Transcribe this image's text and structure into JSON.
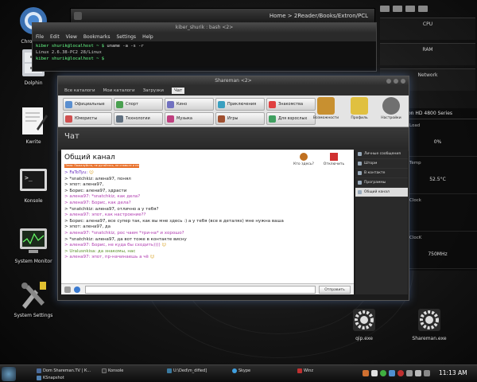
{
  "desktop": {
    "icons": [
      {
        "label": "Chromium",
        "icon": "chromium-icon"
      },
      {
        "label": "Dolphin",
        "icon": "dolphin-icon"
      },
      {
        "label": "Kwrite",
        "icon": "kwrite-icon"
      },
      {
        "label": "Konsole",
        "icon": "konsole-icon"
      },
      {
        "label": "System Monitor",
        "icon": "system-monitor-icon"
      },
      {
        "label": "System Settings",
        "icon": "system-settings-icon"
      }
    ],
    "big_icons": [
      {
        "label": "qip.exe",
        "icon": "gear-icon"
      },
      {
        "label": "Shareman.exe",
        "icon": "gear-icon"
      }
    ]
  },
  "pathbar": {
    "path": "Home > 2Reader/Books/Extron/PCL"
  },
  "terminal": {
    "title": "kiber_shurik : bash <2>",
    "menu": [
      "File",
      "Edit",
      "View",
      "Bookmarks",
      "Settings",
      "Help"
    ],
    "lines": [
      {
        "prompt": "kiber shurik@localhost ~ $",
        "cmd": "uname -a -s -r"
      },
      {
        "out": "Linux 2.6.38-PC2 28/Linux"
      },
      {
        "prompt": "kiber shurik@localhost ~ $",
        "cmd": ""
      }
    ]
  },
  "sysmon": {
    "blocks": [
      "CPU",
      "RAM",
      "Network"
    ]
  },
  "gpu": {
    "header": "on HD 4800 Series",
    "rows": [
      {
        "key": "Load",
        "value": "0%"
      },
      {
        "key": "Temp",
        "value": "52.5°C"
      },
      {
        "key": "Clock",
        "value": ""
      },
      {
        "key": "ClocK",
        "value": "750MHz"
      }
    ]
  },
  "window": {
    "title": "Shareman <2>",
    "tabs": [
      "Все каталоги",
      "Мои каталоги",
      "Загрузки",
      "Чат"
    ],
    "active_tab": "Чат",
    "toolbar_buttons": [
      {
        "label": "Официальные",
        "color": "#5a8fd0"
      },
      {
        "label": "Спорт",
        "color": "#4aa050"
      },
      {
        "label": "Кино",
        "color": "#7070c0"
      },
      {
        "label": "Приключения",
        "color": "#3aa0c0"
      },
      {
        "label": "Знакомства",
        "color": "#e04040"
      },
      {
        "label": "Юмористы",
        "color": "#d05050"
      },
      {
        "label": "Технологии",
        "color": "#607080"
      },
      {
        "label": "Музыка",
        "color": "#c04080"
      },
      {
        "label": "Игры",
        "color": "#a05030"
      },
      {
        "label": "Для взрослых",
        "color": "#40a060"
      }
    ],
    "extra_tab": "Ш ed",
    "big_buttons": [
      {
        "label": "Возможности",
        "color": "#c89030"
      },
      {
        "label": "Профиль",
        "color": "#e0c040"
      },
      {
        "label": "Настройки",
        "color": "#707070"
      }
    ],
    "section_title": "Чат",
    "channel": {
      "title": "Общий канал",
      "topic": "Тема: Пожалуйста, не ругайтесь, не спамьте и не флудите!",
      "actions": [
        {
          "label": "Кто здесь?",
          "color": "#c07020"
        },
        {
          "label": "Отключить",
          "color": "#d03030"
        }
      ],
      "messages": [
        {
          "text": "> FaToTyu:",
          "color": "#6a2fbf",
          "emoji": true
        },
        {
          "text": "> *snatchkiz: алена97, понял",
          "color": "#222"
        },
        {
          "text": "> эпот: алена97,",
          "color": "#222"
        },
        {
          "text": "> Борис: алена97, здрасти",
          "color": "#222"
        },
        {
          "text": "> алена97: *snatchkiz, как дела?",
          "color": "#b03cb0"
        },
        {
          "text": "> алена97: Борис, как дела?",
          "color": "#b03cb0"
        },
        {
          "text": "> *snatchkiz: алена97, отлично а у тебя?",
          "color": "#222"
        },
        {
          "text": "> алена97: эпот, как настроение??",
          "color": "#b03cb0"
        },
        {
          "text": "> Борис: алена97, все супер так, как вы мне здесь :) а у тебя (все в деталях) мне нужна ваша",
          "color": "#222"
        },
        {
          "text": "> эпот: алена97, да",
          "color": "#222"
        },
        {
          "text": "> алена97: *snatchkiz, рос чаем *три-на* и хорошо?",
          "color": "#b03cb0"
        },
        {
          "text": "> *snatchkiz: алена97, да вот тоже в контакте висну",
          "color": "#222"
        },
        {
          "text": "> алена97: Борис, не куда бы сходить))))",
          "color": "#b03cb0",
          "emoji": true
        },
        {
          "text": "> Uralusnkisa: да знакомы, нас",
          "color": "#5a8f2a"
        },
        {
          "text": "> алена97: эпот, пр-начинаешь а чё",
          "color": "#b03cb0",
          "emoji": true
        }
      ],
      "input_placeholder": "",
      "send_label": "Отправить"
    },
    "right_list": [
      {
        "label": "Личные сообщения",
        "selected": false
      },
      {
        "label": "Шторм",
        "selected": false
      },
      {
        "label": "В контакте",
        "selected": false
      },
      {
        "label": "Программы",
        "selected": false
      },
      {
        "label": "Общий канал",
        "selected": true
      }
    ]
  },
  "taskbar": {
    "items": [
      {
        "label": "Dom Shareman.TV | К...",
        "color": "#4a6a9a"
      },
      {
        "label": "KSnapshot",
        "color": "#5080b0"
      },
      {
        "label": "Konsole",
        "color": "#333"
      },
      {
        "label": "U:\\Ded\\m_dified]",
        "color": "#3a7aa0"
      },
      {
        "label": "Skype",
        "color": "#40a0e0"
      },
      {
        "label": "Winz",
        "color": "#c03030"
      }
    ],
    "clock": "11:13 AM"
  }
}
